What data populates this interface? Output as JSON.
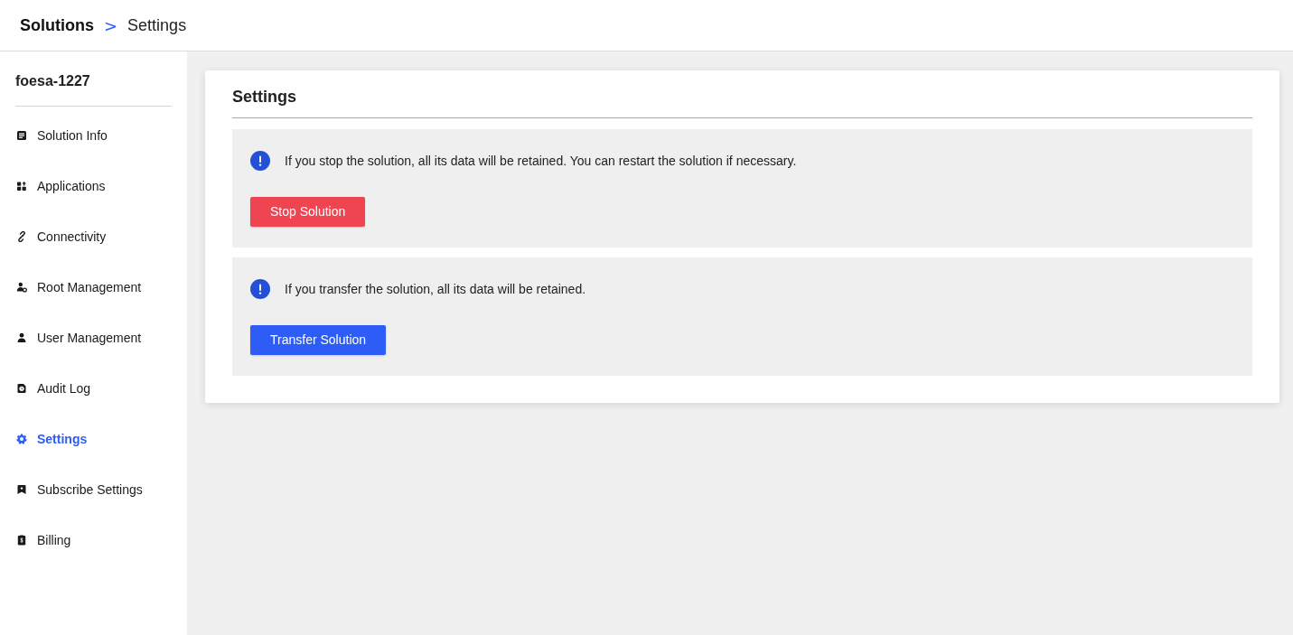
{
  "breadcrumb": {
    "parent": "Solutions",
    "separator": ">",
    "current": "Settings"
  },
  "sidebar": {
    "title": "foesa-1227",
    "items": [
      {
        "label": "Solution Info",
        "selected": false
      },
      {
        "label": "Applications",
        "selected": false
      },
      {
        "label": "Connectivity",
        "selected": false
      },
      {
        "label": "Root Management",
        "selected": false
      },
      {
        "label": "User Management",
        "selected": false
      },
      {
        "label": "Audit Log",
        "selected": false
      },
      {
        "label": "Settings",
        "selected": true
      },
      {
        "label": "Subscribe Settings",
        "selected": false
      },
      {
        "label": "Billing",
        "selected": false
      }
    ]
  },
  "card": {
    "title": "Settings",
    "panels": [
      {
        "message": "If you stop the solution, all its data will be retained. You can restart the solution if necessary.",
        "button": {
          "label": "Stop Solution",
          "kind": "danger"
        }
      },
      {
        "message": "If you transfer the solution, all its data will be retained.",
        "button": {
          "label": "Transfer Solution",
          "kind": "primary"
        }
      }
    ]
  }
}
